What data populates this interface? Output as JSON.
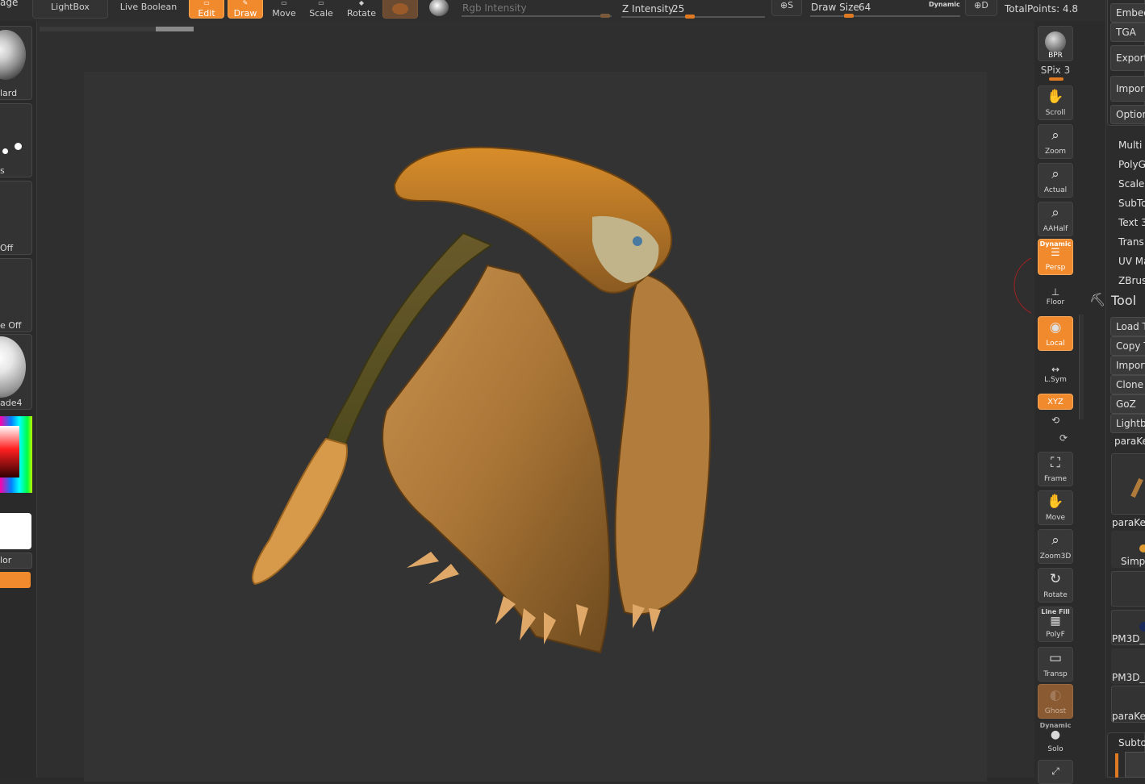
{
  "toolbar": {
    "lightbox": "LightBox",
    "live_boolean": "Live Boolean",
    "edit": "Edit",
    "draw": "Draw",
    "move": "Move",
    "scale": "Scale",
    "rotate": "Rotate",
    "rgb_intensity_label": "Rgb Intensity",
    "z_intensity_label": "Z Intensity",
    "z_intensity_value": "25",
    "s_label": "S",
    "draw_size_label": "Draw Size",
    "draw_size_value": "64",
    "dynamic_label": "Dynamic",
    "d_label": "D",
    "total_points": "TotalPoints: 4.8",
    "page_tab_fragment": "age"
  },
  "left_shelf": {
    "brush_label": "lard",
    "stroke_label": "s",
    "alpha_label": "Off",
    "texture_label": "e Off",
    "material_label": "ade4",
    "color_label": "lor"
  },
  "right_shelf": {
    "bpr": "BPR",
    "spix": "SPix 3",
    "scroll": "Scroll",
    "zoom": "Zoom",
    "actual": "Actual",
    "aahalf": "AAHalf",
    "persp_dynamic": "Dynamic",
    "persp": "Persp",
    "floor": "Floor",
    "local": "Local",
    "lsym": "L.Sym",
    "xyz": "XYZ",
    "frame": "Frame",
    "move": "Move",
    "zoom3d": "Zoom3D",
    "rotate": "Rotate",
    "linefill": "Line Fill",
    "polyf": "PolyF",
    "transp": "Transp",
    "ghost": "Ghost",
    "solo_dynamic": "Dynamic",
    "solo": "Solo"
  },
  "right_panel": {
    "embed": "Embed",
    "tga": "TGA",
    "export": "Export",
    "import": "Impor",
    "options": "Option",
    "plugins": [
      "Multi I",
      "PolyG",
      "Scale",
      "SubTo",
      "Text 3",
      "Trans",
      "UV Ma",
      "ZBrus"
    ],
    "tool_title": "Tool",
    "load_tool": "Load T",
    "copy_tool": "Copy T",
    "import_tool": "Import",
    "clone": "Clone",
    "goz": "GoZ",
    "lightbox": "Lightbo",
    "current_tool": "paraKe",
    "thumbs": [
      "paraKe",
      "Simpl",
      "PM3D_",
      "PM3D_",
      "paraKe"
    ],
    "subtool": "Subto"
  }
}
